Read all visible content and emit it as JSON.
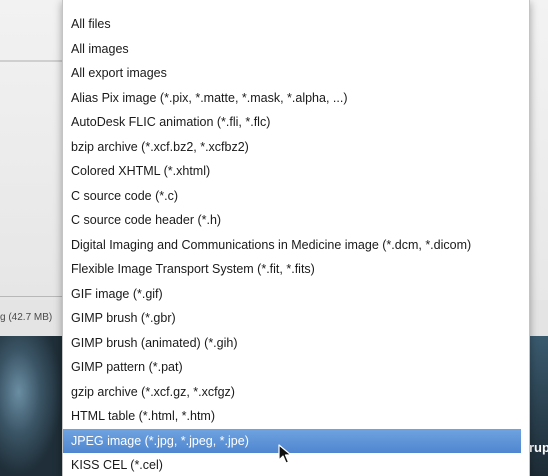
{
  "background": {
    "size_label": "g (42.7 MB)",
    "partial_text": "rup"
  },
  "menu": {
    "selected_index": 19,
    "items": [
      {
        "label": "All files"
      },
      {
        "label": "All images"
      },
      {
        "label": "All export images"
      },
      {
        "label": "Alias Pix image (*.pix, *.matte, *.mask, *.alpha, ...)"
      },
      {
        "label": "AutoDesk FLIC animation (*.fli, *.flc)"
      },
      {
        "label": "bzip archive (*.xcf.bz2, *.xcfbz2)"
      },
      {
        "label": "Colored XHTML (*.xhtml)"
      },
      {
        "label": "C source code (*.c)"
      },
      {
        "label": "C source code header (*.h)"
      },
      {
        "label": "Digital Imaging and Communications in Medicine image (*.dcm, *.dicom)"
      },
      {
        "label": "Flexible Image Transport System (*.fit, *.fits)"
      },
      {
        "label": "GIF image (*.gif)"
      },
      {
        "label": "GIMP brush (*.gbr)"
      },
      {
        "label": "GIMP brush (animated) (*.gih)"
      },
      {
        "label": "GIMP pattern (*.pat)"
      },
      {
        "label": "gzip archive (*.xcf.gz, *.xcfgz)"
      },
      {
        "label": "HTML table (*.html, *.htm)"
      },
      {
        "label": "JPEG image (*.jpg, *.jpeg, *.jpe)"
      },
      {
        "label": "KISS CEL (*.cel)"
      }
    ]
  },
  "colors": {
    "selection": "#4f86cf",
    "popup_bg": "#ffffff",
    "text": "#1a1a1a"
  },
  "icons": {
    "cursor": "mouse-pointer-icon"
  }
}
